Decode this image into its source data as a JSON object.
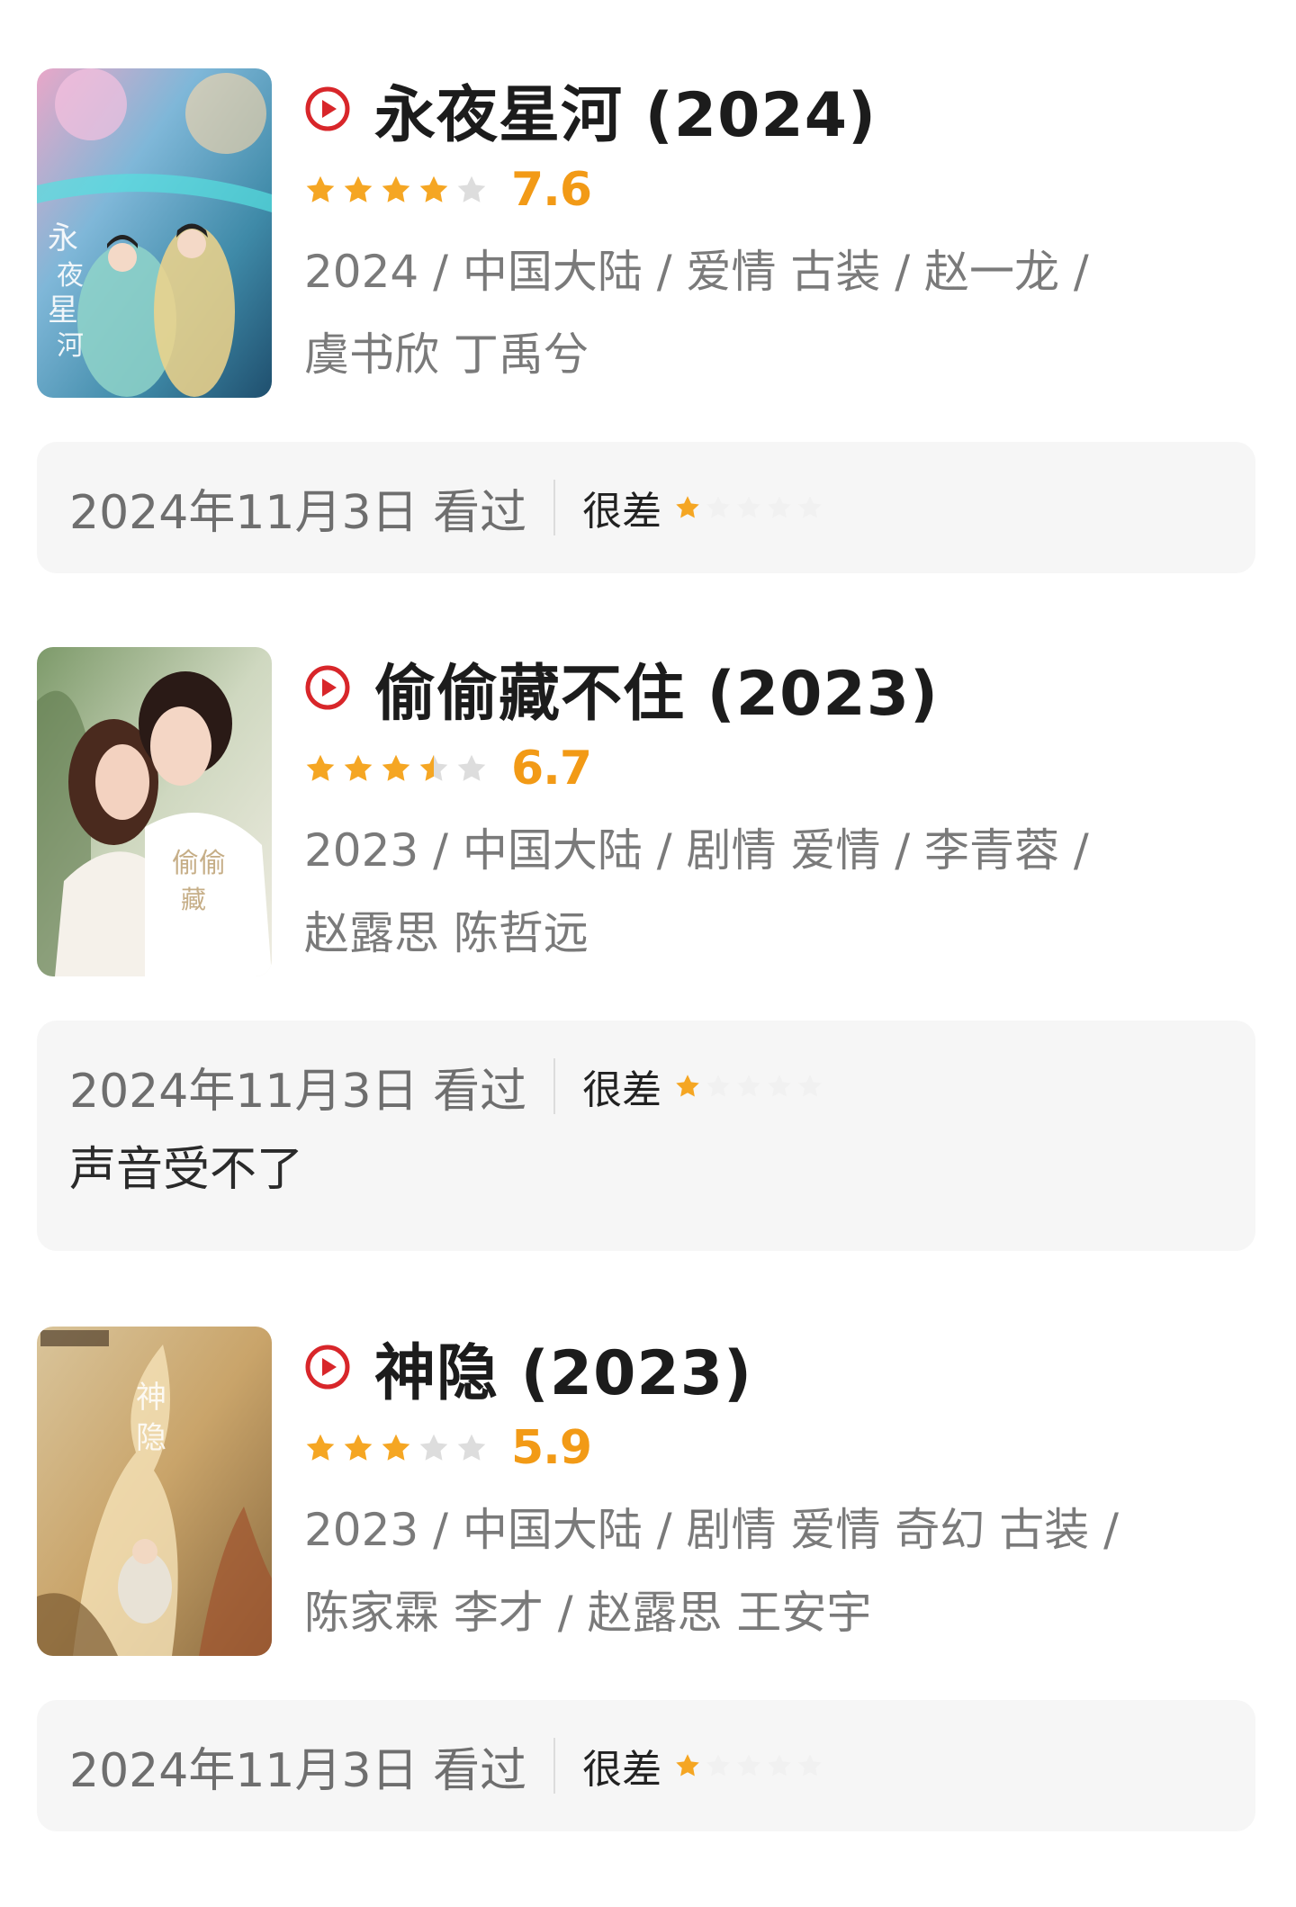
{
  "colors": {
    "accent_red": "#d8262a",
    "star_gold": "#f5a623",
    "star_empty": "#dddddd",
    "score_orange": "#f29a16",
    "card_bg": "#f6f6f6"
  },
  "icons": {
    "play": "play-circle-icon",
    "star": "star-icon"
  },
  "entries": [
    {
      "title": "永夜星河 (2024)",
      "rating_stars": 4,
      "score": "7.6",
      "meta_line1": "2024 / 中国大陆 / 爱情 古装 / 赵一龙 /",
      "meta_line2": "虞书欣 丁禹兮",
      "watched": "2024年11月3日 看过",
      "verdict": "很差",
      "user_stars": 1,
      "comment": ""
    },
    {
      "title": "偷偷藏不住 (2023)",
      "rating_stars": 3.5,
      "score": "6.7",
      "meta_line1": "2023 / 中国大陆 / 剧情 爱情 / 李青蓉 /",
      "meta_line2": "赵露思 陈哲远",
      "watched": "2024年11月3日 看过",
      "verdict": "很差",
      "user_stars": 1,
      "comment": "声音受不了"
    },
    {
      "title": "神隐 (2023)",
      "rating_stars": 3,
      "score": "5.9",
      "meta_line1": "2023 / 中国大陆 / 剧情 爱情 奇幻 古装 /",
      "meta_line2": "陈家霖 李才 / 赵露思 王安宇",
      "watched": "2024年11月3日 看过",
      "verdict": "很差",
      "user_stars": 1,
      "comment": ""
    }
  ]
}
